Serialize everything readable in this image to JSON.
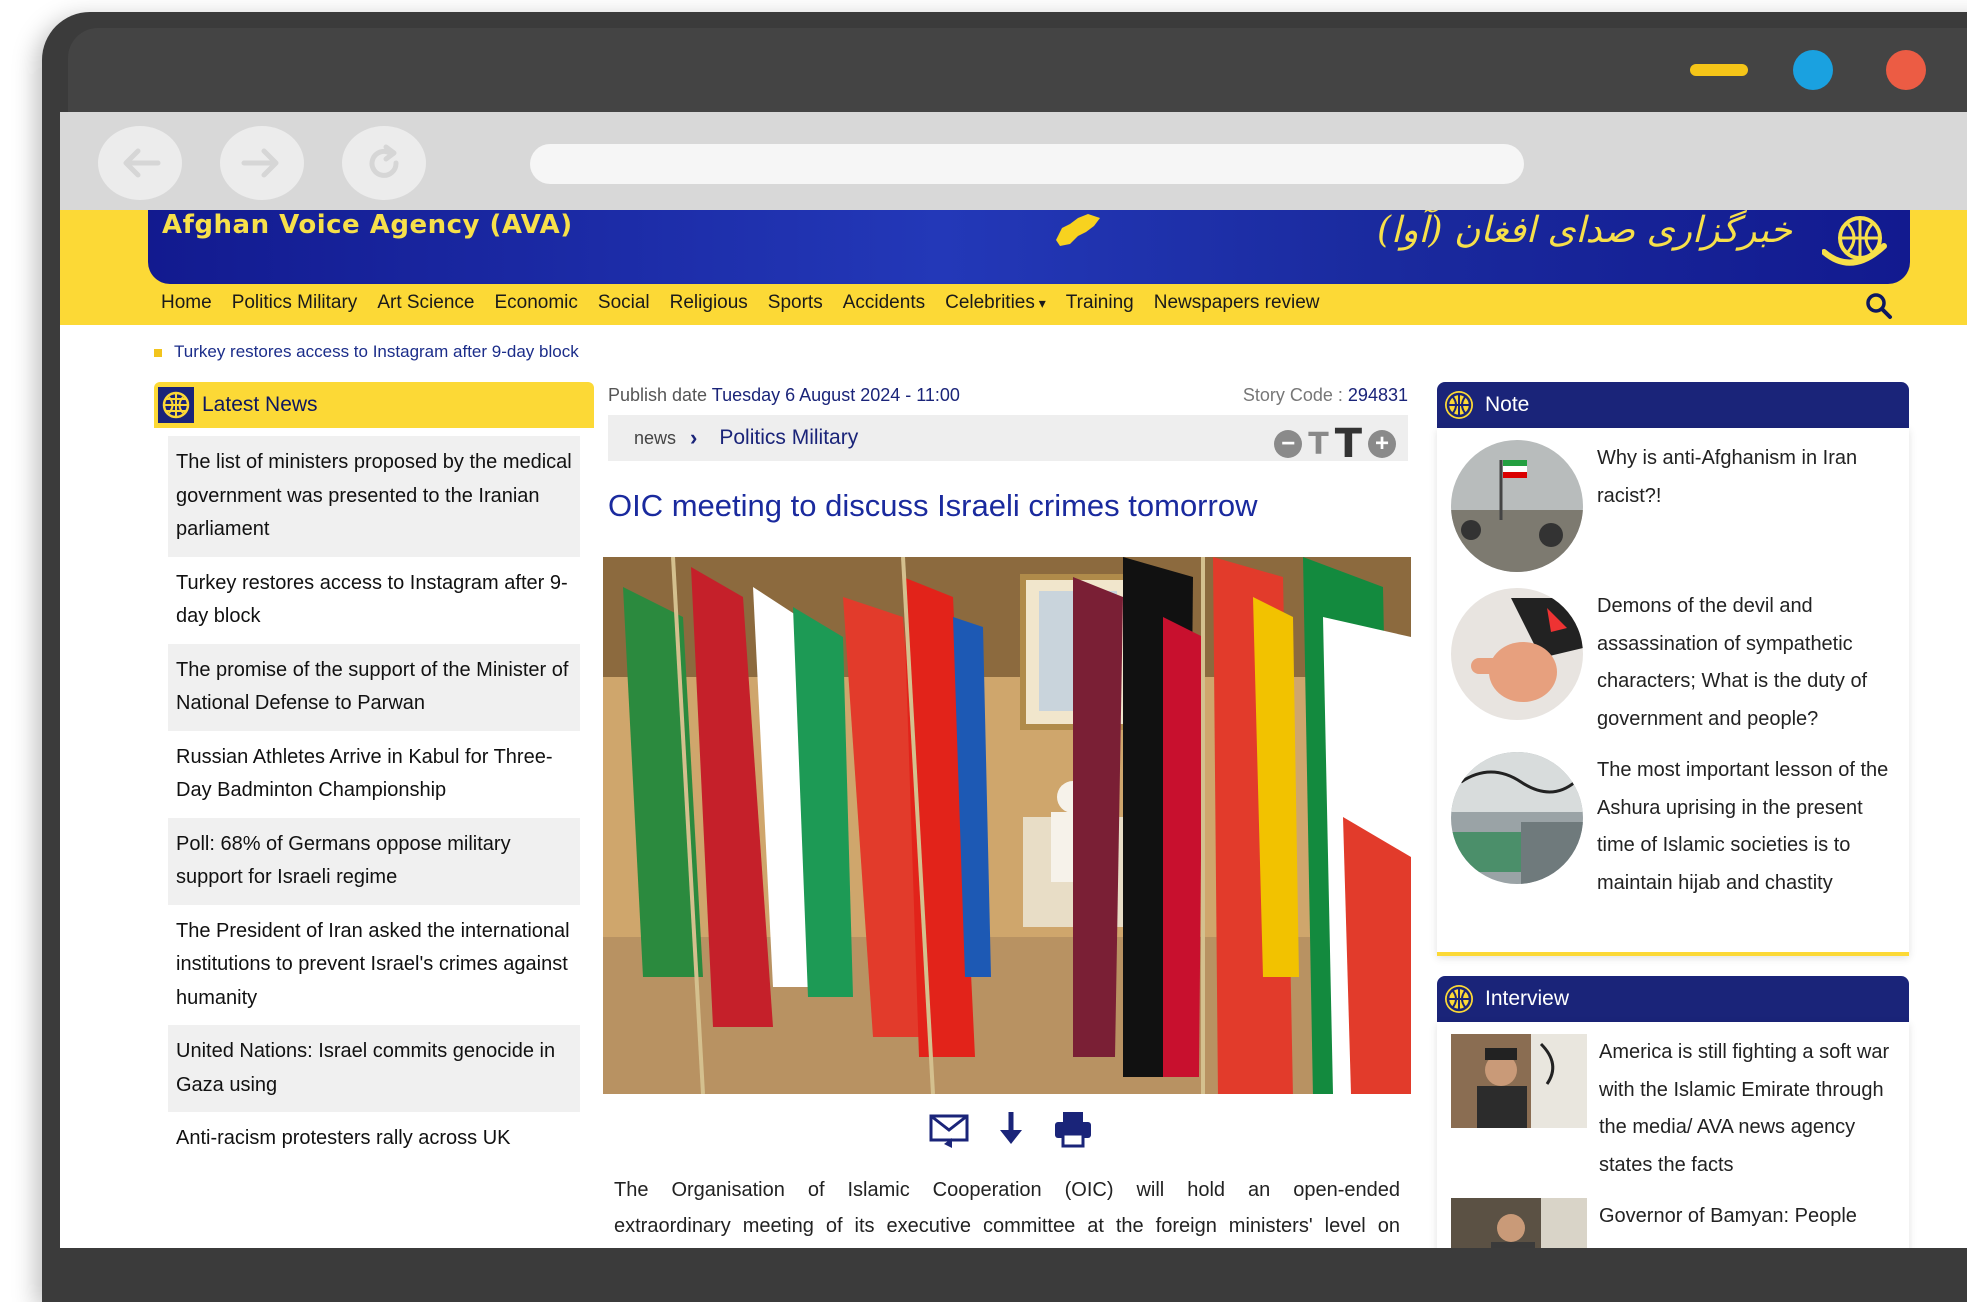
{
  "site": {
    "title_en": "Afghan Voice Agency (AVA)",
    "title_fa": "خبرگزاری صدای افغان (آوا)"
  },
  "nav": {
    "items": [
      "Home",
      "Politics Military",
      "Art Science",
      "Economic",
      "Social",
      "Religious",
      "Sports",
      "Accidents",
      "Celebrities",
      "Training",
      "Newspapers review"
    ]
  },
  "ticker": {
    "text": "Turkey restores access to Instagram after 9-day block"
  },
  "latest": {
    "title": "Latest News",
    "items": [
      "The list of ministers proposed by the medical government was presented to the Iranian parliament",
      "Turkey restores access to Instagram after 9-day block",
      "The promise of the support of the Minister of National Defense to Parwan",
      "Russian Athletes Arrive in Kabul for Three-Day Badminton Championship",
      "Poll: 68% of Germans oppose military support for Israeli regime",
      "The President of Iran asked the international institutions to prevent Israel's crimes against humanity",
      "United Nations: Israel commits genocide in Gaza using",
      "Anti-racism protesters rally across UK"
    ]
  },
  "article": {
    "publish_label": "Publish date",
    "publish_date": "Tuesday 6 August 2024 - 11:00",
    "story_label": "Story Code :",
    "story_code": "294831",
    "crumb_root": "news",
    "crumb_category": "Politics Military",
    "headline": "OIC meeting to discuss Israeli crimes tomorrow",
    "body_line1": "The Organisation of Islamic Cooperation (OIC) will hold an open-ended",
    "body_line2": "extraordinary meeting of its executive committee at the foreign ministers' level on"
  },
  "note": {
    "title": "Note",
    "items": [
      "Why is anti-Afghanism in Iran racist?!",
      "Demons of the devil and assassination of sympathetic characters; What is the duty of government and people?",
      "The most important lesson of the Ashura uprising in the present time of Islamic societies is to maintain hijab and chastity"
    ]
  },
  "interview": {
    "title": "Interview",
    "items": [
      "America is still fighting a soft war with the Islamic Emirate through the media/ AVA news agency states the facts",
      "Governor of Bamyan: People"
    ]
  },
  "colors": {
    "brand_yellow": "#fcd936",
    "brand_navy": "#1a2479",
    "link_blue": "#1a2a9e"
  }
}
